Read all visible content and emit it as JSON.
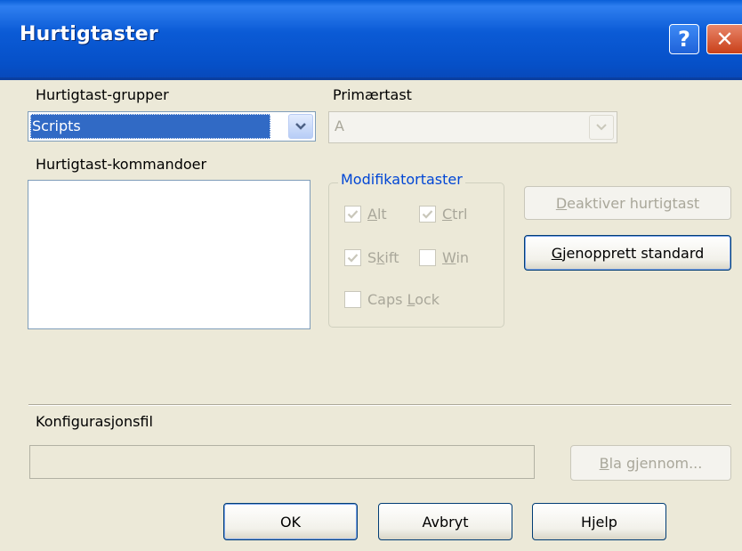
{
  "window": {
    "title": "Hurtigtaster",
    "help_glyph": "?",
    "close_glyph": "✕"
  },
  "labels": {
    "groups": "Hurtigtast-grupper",
    "primary_key": "Primærtast",
    "commands": "Hurtigtast-kommandoer",
    "modifiers": "Modifikatortaster",
    "config_file": "Konfigurasjonsfil"
  },
  "groups_combo": {
    "value": "Scripts"
  },
  "primary_key_combo": {
    "value": "A",
    "enabled": false
  },
  "commands_list": {
    "items": []
  },
  "modifiers": {
    "alt": {
      "pre": "",
      "key": "A",
      "post": "lt",
      "checked": true,
      "enabled": false
    },
    "ctrl": {
      "pre": "",
      "key": "C",
      "post": "trl",
      "checked": true,
      "enabled": false
    },
    "shift": {
      "pre": "S",
      "key": "k",
      "post": "ift",
      "checked": true,
      "enabled": false
    },
    "win": {
      "pre": "",
      "key": "W",
      "post": "in",
      "checked": false,
      "enabled": false
    },
    "caps": {
      "pre": "Caps ",
      "key": "L",
      "post": "ock",
      "checked": false,
      "enabled": false
    }
  },
  "buttons": {
    "disable_shortcut": {
      "pre": "",
      "key": "D",
      "post": "eaktiver hurtigtast",
      "enabled": false
    },
    "restore_default": {
      "pre": "",
      "key": "G",
      "post": "jenopprett standard",
      "enabled": true
    },
    "browse": {
      "pre": "",
      "key": "B",
      "post": "la gjennom...",
      "enabled": false
    },
    "ok": "OK",
    "cancel": "Avbryt",
    "help": "Hjelp"
  },
  "config_file": {
    "value": ""
  },
  "colors": {
    "titlebar": "#0b5bd6",
    "dialog_bg": "#ece9d8",
    "selection": "#316ac5",
    "groupbox_title": "#0046d5",
    "disabled_text": "#a9a79a"
  }
}
